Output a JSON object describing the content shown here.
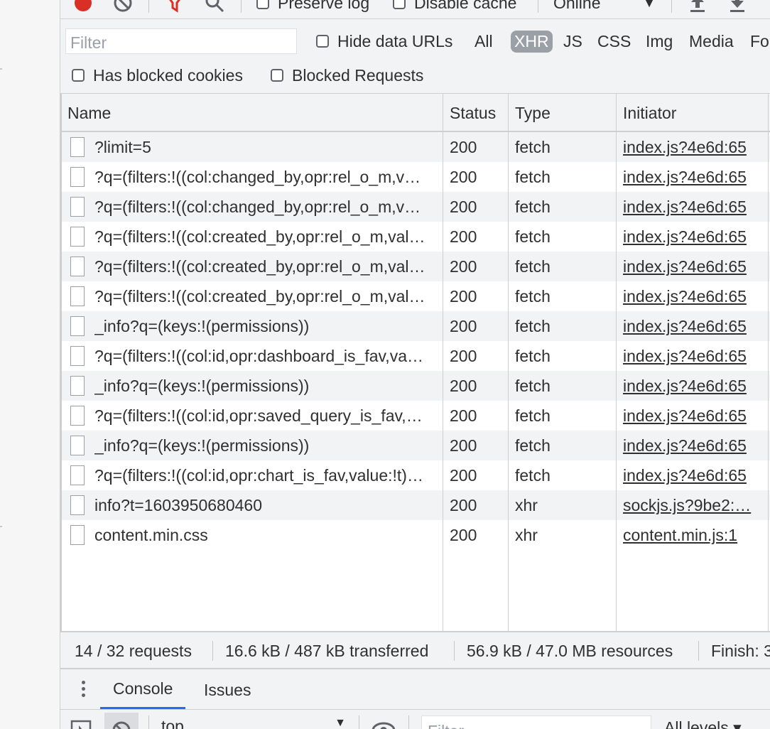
{
  "toolbar": {
    "preserve_log": "Preserve log",
    "disable_cache": "Disable cache",
    "throttle": "Online"
  },
  "filter": {
    "placeholder": "Filter",
    "hide_data_urls": "Hide data URLs",
    "types": [
      "All",
      "XHR",
      "JS",
      "CSS",
      "Img",
      "Media",
      "Fo"
    ],
    "active_type": "XHR",
    "has_blocked_cookies": "Has blocked cookies",
    "blocked_requests": "Blocked Requests"
  },
  "table": {
    "headers": {
      "name": "Name",
      "status": "Status",
      "type": "Type",
      "initiator": "Initiator"
    },
    "rows": [
      {
        "name": "?limit=5",
        "status": "200",
        "type": "fetch",
        "initiator": "index.js?4e6d:65"
      },
      {
        "name": "?q=(filters:!((col:changed_by,opr:rel_o_m,v…",
        "status": "200",
        "type": "fetch",
        "initiator": "index.js?4e6d:65"
      },
      {
        "name": "?q=(filters:!((col:changed_by,opr:rel_o_m,v…",
        "status": "200",
        "type": "fetch",
        "initiator": "index.js?4e6d:65"
      },
      {
        "name": "?q=(filters:!((col:created_by,opr:rel_o_m,val…",
        "status": "200",
        "type": "fetch",
        "initiator": "index.js?4e6d:65"
      },
      {
        "name": "?q=(filters:!((col:created_by,opr:rel_o_m,val…",
        "status": "200",
        "type": "fetch",
        "initiator": "index.js?4e6d:65"
      },
      {
        "name": "?q=(filters:!((col:created_by,opr:rel_o_m,val…",
        "status": "200",
        "type": "fetch",
        "initiator": "index.js?4e6d:65"
      },
      {
        "name": "_info?q=(keys:!(permissions))",
        "status": "200",
        "type": "fetch",
        "initiator": "index.js?4e6d:65"
      },
      {
        "name": "?q=(filters:!((col:id,opr:dashboard_is_fav,va…",
        "status": "200",
        "type": "fetch",
        "initiator": "index.js?4e6d:65"
      },
      {
        "name": "_info?q=(keys:!(permissions))",
        "status": "200",
        "type": "fetch",
        "initiator": "index.js?4e6d:65"
      },
      {
        "name": "?q=(filters:!((col:id,opr:saved_query_is_fav,…",
        "status": "200",
        "type": "fetch",
        "initiator": "index.js?4e6d:65"
      },
      {
        "name": "_info?q=(keys:!(permissions))",
        "status": "200",
        "type": "fetch",
        "initiator": "index.js?4e6d:65"
      },
      {
        "name": "?q=(filters:!((col:id,opr:chart_is_fav,value:!t)…",
        "status": "200",
        "type": "fetch",
        "initiator": "index.js?4e6d:65"
      },
      {
        "name": "info?t=1603950680460",
        "status": "200",
        "type": "xhr",
        "initiator": "sockjs.js?9be2:…"
      },
      {
        "name": "content.min.css",
        "status": "200",
        "type": "xhr",
        "initiator": "content.min.js:1"
      }
    ]
  },
  "summary": {
    "requests": "14 / 32 requests",
    "transferred": "16.6 kB / 487 kB transferred",
    "resources": "56.9 kB / 47.0 MB resources",
    "finish": "Finish: 3"
  },
  "drawer": {
    "tabs": [
      "Console",
      "Issues"
    ],
    "context": "top",
    "filter_placeholder": "Filter",
    "levels": "All levels ▾"
  },
  "colors": {
    "record": "#d93025",
    "filter_active": "#d93025",
    "accent": "#1a73e8",
    "pill": "#9aa0a6"
  }
}
